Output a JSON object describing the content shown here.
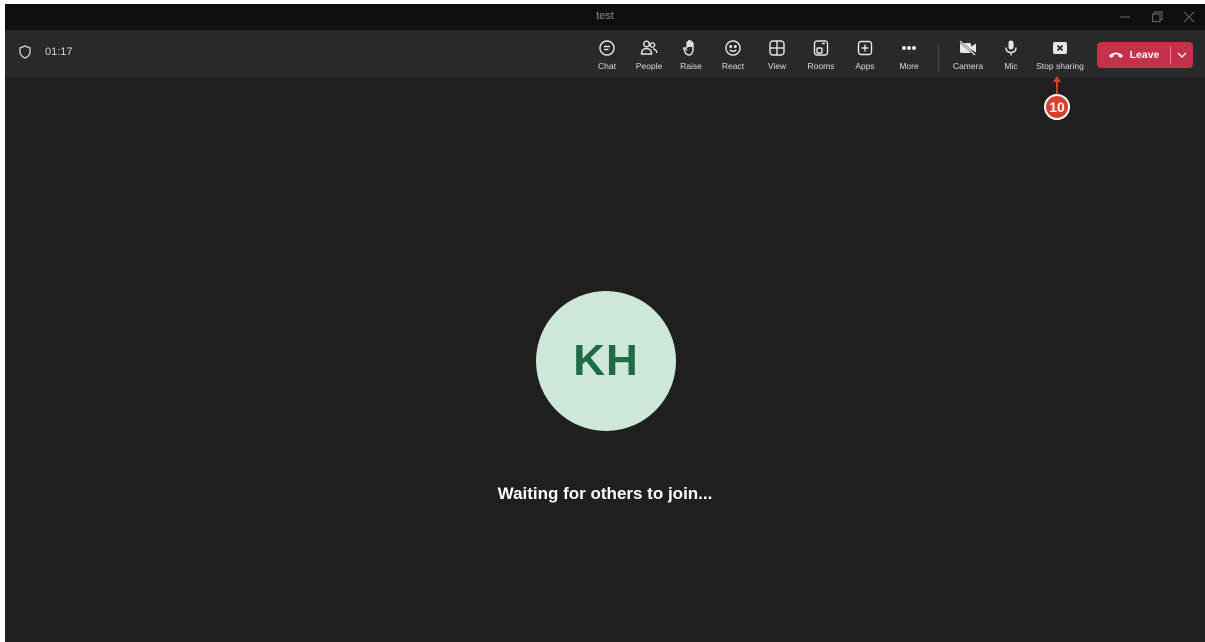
{
  "window": {
    "title": "test"
  },
  "meeting": {
    "timer": "01:17"
  },
  "toolbar": {
    "items": [
      {
        "id": "chat",
        "label": "Chat",
        "icon": "chat-icon"
      },
      {
        "id": "people",
        "label": "People",
        "icon": "people-icon"
      },
      {
        "id": "raise",
        "label": "Raise",
        "icon": "raise-hand-icon"
      },
      {
        "id": "react",
        "label": "React",
        "icon": "smiley-icon"
      },
      {
        "id": "view",
        "label": "View",
        "icon": "grid-view-icon"
      },
      {
        "id": "rooms",
        "label": "Rooms",
        "icon": "breakout-rooms-icon"
      },
      {
        "id": "apps",
        "label": "Apps",
        "icon": "add-app-icon"
      },
      {
        "id": "more",
        "label": "More",
        "icon": "more-dots-icon"
      },
      {
        "id": "camera",
        "label": "Camera",
        "icon": "camera-off-icon"
      },
      {
        "id": "mic",
        "label": "Mic",
        "icon": "microphone-icon"
      },
      {
        "id": "stop_sharing",
        "label": "Stop sharing",
        "icon": "stop-share-icon"
      }
    ],
    "leave_label": "Leave"
  },
  "annotation": {
    "number": "10",
    "color": "#d9412f"
  },
  "stage": {
    "avatar_initials": "KH",
    "status_text": "Waiting for others to join..."
  },
  "colors": {
    "background": "#1f1f1f",
    "toolbar": "#292929",
    "titlebar": "#0f0f0f",
    "leave": "#c4314b",
    "avatar_bg": "#cde8d8",
    "avatar_text": "#1e6b46"
  }
}
